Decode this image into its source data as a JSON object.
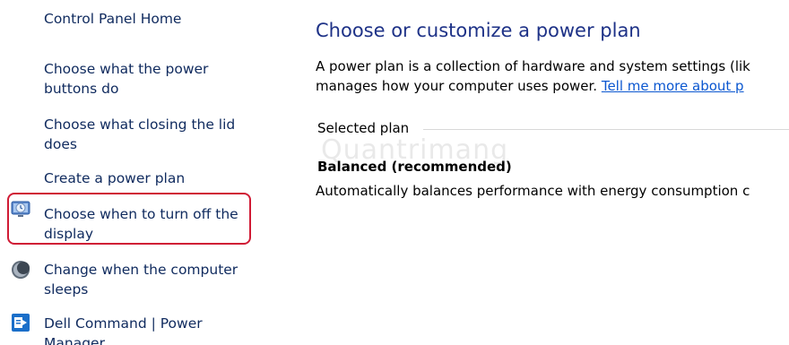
{
  "nav": {
    "home": "Control Panel Home",
    "items": [
      {
        "lines": [
          "Choose what the power",
          "buttons do"
        ]
      },
      {
        "lines": [
          "Choose what closing the lid",
          "does"
        ]
      },
      {
        "lines": [
          "Create a power plan"
        ]
      },
      {
        "lines": [
          "Choose when to turn off the",
          "display"
        ],
        "icon": "display-power-icon",
        "highlighted": true
      },
      {
        "lines": [
          "Change when the computer",
          "sleeps"
        ],
        "icon": "moon-sleep-icon"
      },
      {
        "lines": [
          "Dell Command | Power",
          "Manager"
        ],
        "icon": "dell-command-icon"
      }
    ]
  },
  "main": {
    "title": "Choose or customize a power plan",
    "description_line1": "A power plan is a collection of hardware and system settings (lik",
    "description_line2_text": "manages how your computer uses power. ",
    "description_link": "Tell me more about p",
    "group_label": "Selected plan",
    "plan_name": "Balanced (recommended)",
    "plan_description": "Automatically balances performance with energy consumption c"
  },
  "watermark": "Quantrimang",
  "colors": {
    "highlight": "#d01b35",
    "link": "#0b57d0",
    "title": "#1e3287",
    "nav_text": "#0f2a5e"
  }
}
